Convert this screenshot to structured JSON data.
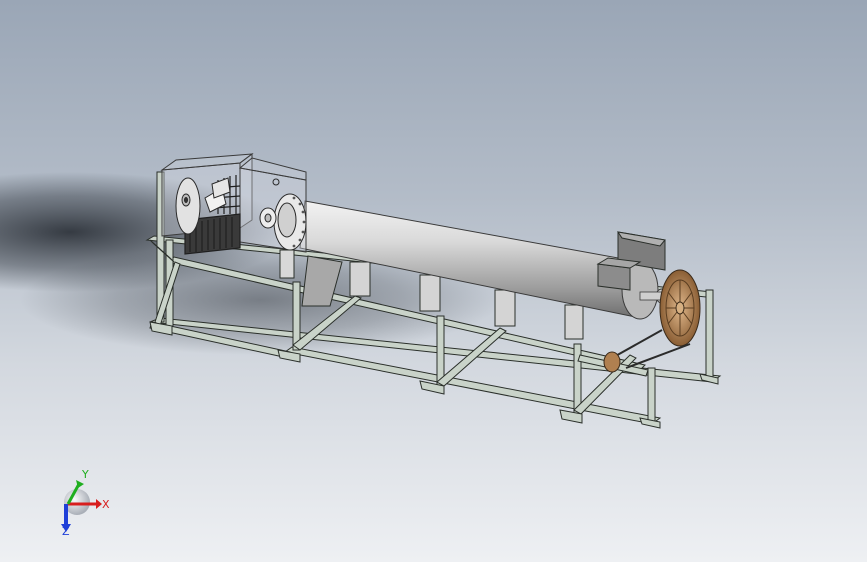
{
  "viewport": {
    "background_top": "#9aa6b6",
    "background_bottom": "#eef0f3"
  },
  "model": {
    "frame_color": "#c9d3c9",
    "frame_edge": "#2a2f2a",
    "drum_color": "#c8c8c8",
    "pulley_color": "#b8895c"
  },
  "triad": {
    "x_label": "X",
    "y_label": "Y",
    "z_label": "Z",
    "x_color": "#d81e1e",
    "y_color": "#1fae1f",
    "z_color": "#1f3fd8"
  }
}
